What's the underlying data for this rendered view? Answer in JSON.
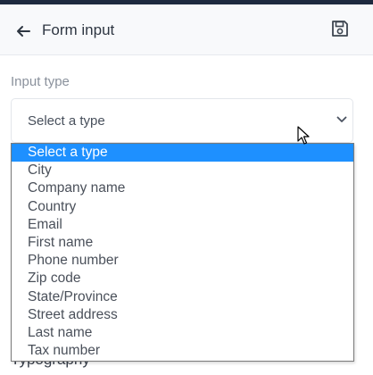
{
  "header": {
    "title": "Form input",
    "back_icon": "arrow-left-icon",
    "save_icon": "floppy-disk-icon"
  },
  "input_type": {
    "label": "Input type",
    "selected_value": "Select a type",
    "options": [
      "Select a type",
      "City",
      "Company name",
      "Country",
      "Email",
      "First name",
      "Phone number",
      "Zip code",
      "State/Province",
      "Street address",
      "Last name",
      "Tax number"
    ],
    "highlighted_option": "Select a type"
  },
  "next_section": {
    "title": "Typography"
  },
  "colors": {
    "top_strip": "#1e2a3f",
    "highlight": "#1e90ff",
    "header_bg": "#f8f9fb"
  }
}
